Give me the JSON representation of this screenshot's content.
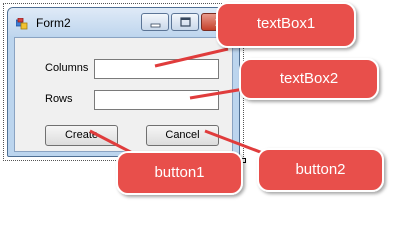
{
  "window": {
    "title": "Form2"
  },
  "form": {
    "columns_label": "Columns",
    "rows_label": "Rows",
    "columns_value": "",
    "rows_value": "",
    "create_label": "Create",
    "cancel_label": "Cancel"
  },
  "callouts": {
    "textbox1": "textBox1",
    "textbox2": "textBox2",
    "button1": "button1",
    "button2": "button2"
  },
  "colors": {
    "callout_fill": "#e8504b",
    "callout_border": "#ffffff",
    "arrow": "#e03c3c"
  },
  "icons": [
    "form-app-icon",
    "minimize-icon",
    "maximize-icon",
    "close-icon"
  ]
}
